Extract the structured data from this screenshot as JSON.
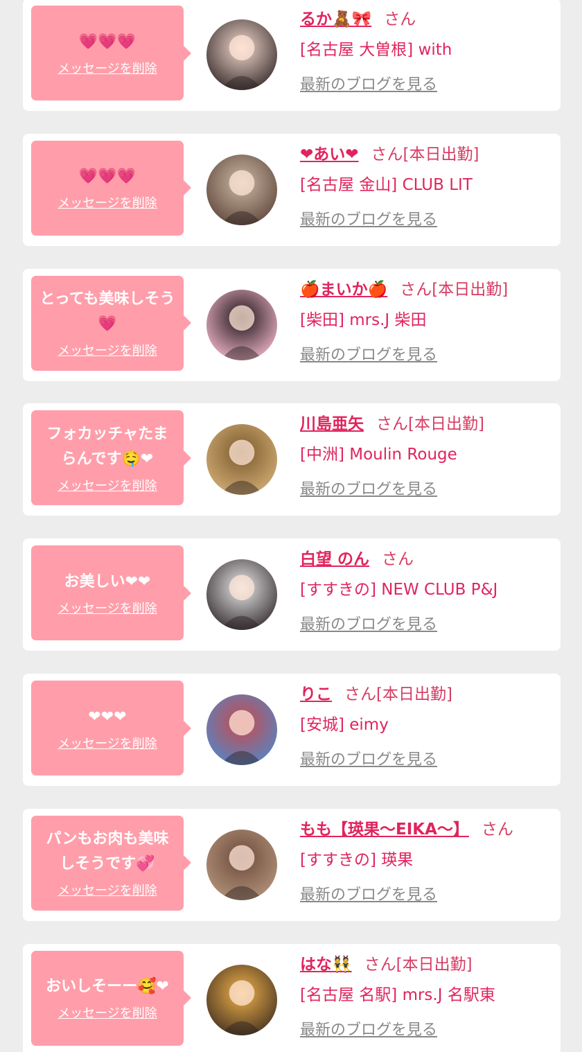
{
  "theme": {
    "background": "#ededed",
    "card": "#ffffff",
    "bubble": "#ff9eaa",
    "name_color": "#e0245e",
    "link_color": "#888888"
  },
  "labels": {
    "delete": "メッセージを削除",
    "blog": "最新のブログを見る"
  },
  "items": [
    {
      "message": "💗💗💗",
      "name": "るか🧸🎀",
      "suffix": "さん",
      "shop": "[名古屋 大曽根] with",
      "avatar_colors": [
        "#f3d9cf",
        "#2b2120"
      ]
    },
    {
      "message": "💗💗💗",
      "name": "❤あい❤",
      "suffix": "さん[本日出勤]",
      "shop": "[名古屋 金山] CLUB LIT",
      "avatar_colors": [
        "#cbb9a6",
        "#5a4034"
      ]
    },
    {
      "message": "とっても美味しそう💗",
      "name": "🍎まいか🍎",
      "suffix": "さん[本日出勤]",
      "shop": "[柴田] mrs.J 柴田",
      "avatar_colors": [
        "#1c1417",
        "#ffc0d4"
      ]
    },
    {
      "message": "フォカッチャたまらんです🤤❤",
      "name": "川島亜矢",
      "suffix": "さん[本日出勤]",
      "shop": "[中洲] Moulin Rouge",
      "avatar_colors": [
        "#7a5a2c",
        "#d8b27a"
      ]
    },
    {
      "message": "お美しい❤❤",
      "name": "白望 のん",
      "suffix": "さん",
      "shop": "[すすきの] NEW CLUB P&J",
      "avatar_colors": [
        "#e8e8e8",
        "#2a2226"
      ]
    },
    {
      "message": "❤❤❤",
      "name": "りこ",
      "suffix": "さん[本日出勤]",
      "shop": "[安城] eimy",
      "avatar_colors": [
        "#c94a4a",
        "#4a8ad0"
      ]
    },
    {
      "message": "パンもお肉も美味しそうです💞",
      "name": "もも【瑛果〜EIKA〜】",
      "suffix": "さん",
      "shop": "[すすきの] 瑛果",
      "avatar_colors": [
        "#6b4a3a",
        "#b99880"
      ]
    },
    {
      "message": "おいしそーー🥰❤",
      "name": "はな👯",
      "suffix": "さん[本日出勤]",
      "shop": "[名古屋 名駅] mrs.J 名駅東",
      "avatar_colors": [
        "#f0b14a",
        "#3a2a1e"
      ]
    }
  ]
}
